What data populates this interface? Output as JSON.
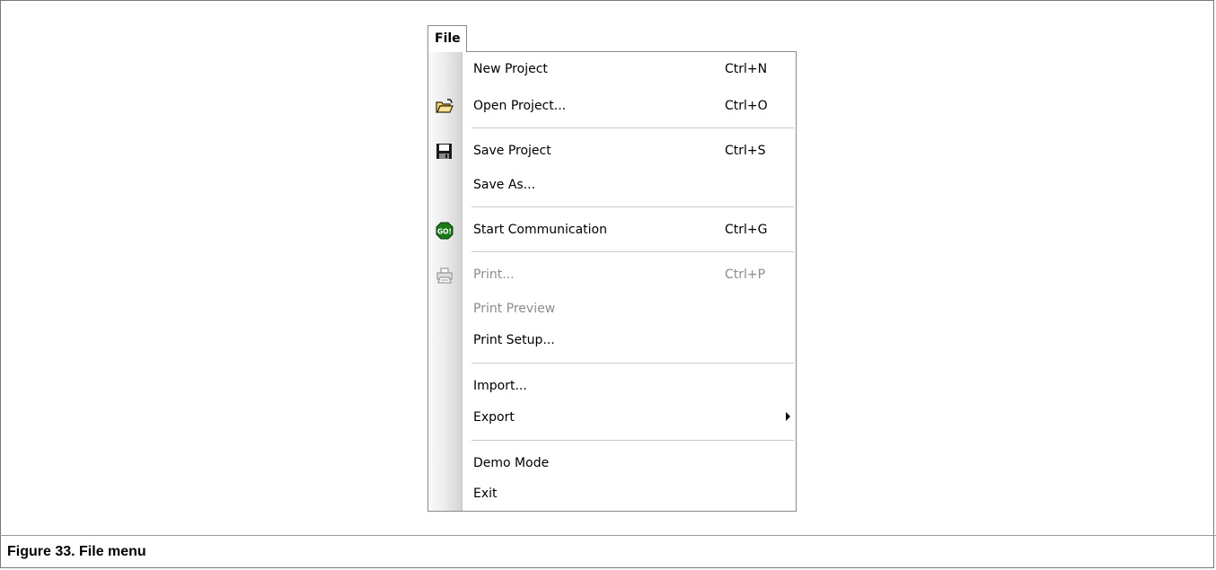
{
  "menu": {
    "title": "File",
    "items": [
      {
        "label": "New Project",
        "shortcut": "Ctrl+N",
        "icon": "none",
        "enabled": true
      },
      {
        "label": "Open Project...",
        "shortcut": "Ctrl+O",
        "icon": "open-folder-icon",
        "enabled": true
      },
      {
        "label": "Save Project",
        "shortcut": "Ctrl+S",
        "icon": "floppy-disk-icon",
        "enabled": true
      },
      {
        "label": "Save As...",
        "shortcut": "",
        "icon": "none",
        "enabled": true
      },
      {
        "label": "Start Communication",
        "shortcut": "Ctrl+G",
        "icon": "go-stop-sign-icon",
        "enabled": true
      },
      {
        "label": "Print...",
        "shortcut": "Ctrl+P",
        "icon": "printer-icon",
        "enabled": false
      },
      {
        "label": "Print Preview",
        "shortcut": "",
        "icon": "none",
        "enabled": false
      },
      {
        "label": "Print Setup...",
        "shortcut": "",
        "icon": "none",
        "enabled": true
      },
      {
        "label": "Import...",
        "shortcut": "",
        "icon": "none",
        "enabled": true
      },
      {
        "label": "Export",
        "shortcut": "",
        "icon": "submenu-arrow-icon",
        "enabled": true
      },
      {
        "label": "Demo Mode",
        "shortcut": "",
        "icon": "none",
        "enabled": true
      },
      {
        "label": "Exit",
        "shortcut": "",
        "icon": "none",
        "enabled": true
      }
    ]
  },
  "icons": {
    "go_text": "GO!"
  },
  "caption": "Figure 33.  File menu",
  "colors": {
    "disabled_text": "#8c8c8c",
    "go_icon_green": "#1a7a1a"
  }
}
